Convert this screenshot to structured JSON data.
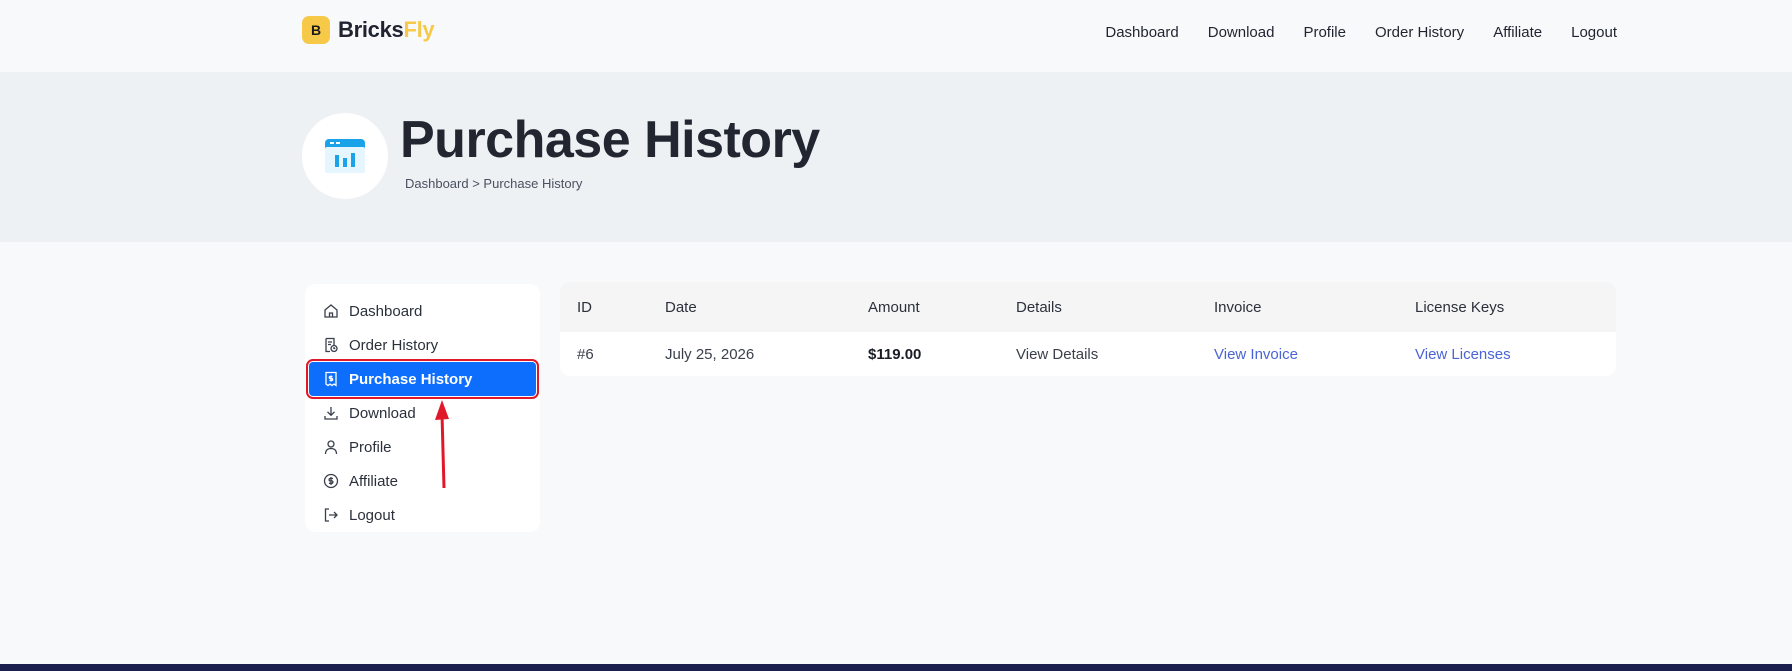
{
  "brand": {
    "name_main": "Bricks",
    "name_accent": "Fly",
    "badge_letter": "B",
    "accent_color": "#f7c948"
  },
  "nav": {
    "items": [
      "Dashboard",
      "Download",
      "Profile",
      "Order History",
      "Affiliate",
      "Logout"
    ]
  },
  "hero": {
    "title": "Purchase History",
    "breadcrumb": "Dashboard > Purchase History",
    "icon": "dashboard-window-icon"
  },
  "sidebar": {
    "items": [
      {
        "label": "Dashboard",
        "icon": "home-icon"
      },
      {
        "label": "Order History",
        "icon": "receipt-clock-icon"
      },
      {
        "label": "Purchase History",
        "icon": "receipt-dollar-icon",
        "active": true
      },
      {
        "label": "Download",
        "icon": "download-icon"
      },
      {
        "label": "Profile",
        "icon": "user-icon"
      },
      {
        "label": "Affiliate",
        "icon": "dollar-circle-icon"
      },
      {
        "label": "Logout",
        "icon": "logout-icon"
      }
    ],
    "active_color": "#0d6efd",
    "highlight_color": "#e0192a"
  },
  "table": {
    "headers": [
      "ID",
      "Date",
      "Amount",
      "Details",
      "Invoice",
      "License Keys"
    ],
    "rows": [
      {
        "id": "#6",
        "date": "July 25, 2026",
        "amount": "$119.00",
        "details": "View Details",
        "invoice": "View Invoice",
        "licenses": "View Licenses"
      }
    ],
    "link_color": "#4a64d6"
  }
}
